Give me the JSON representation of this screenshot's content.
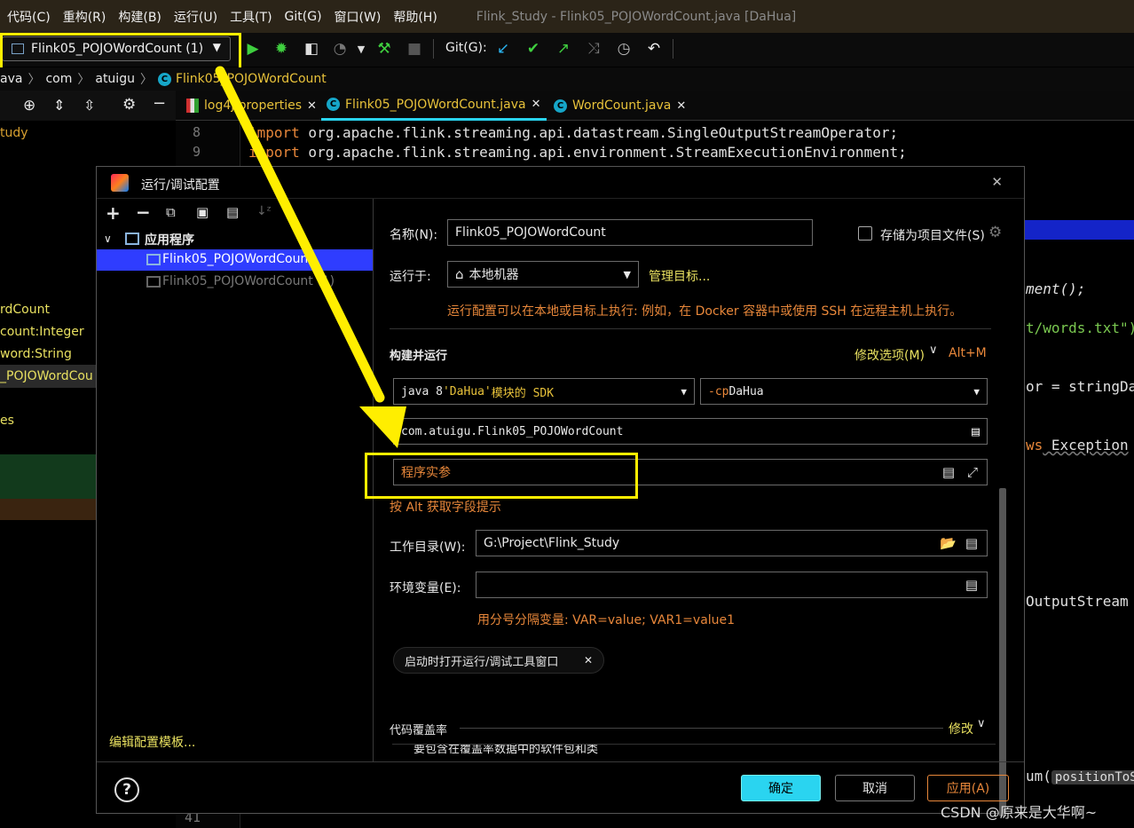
{
  "menu": [
    "代码(C)",
    "重构(R)",
    "构建(B)",
    "运行(U)",
    "工具(T)",
    "Git(G)",
    "窗口(W)",
    "帮助(H)"
  ],
  "window_title": "Flink_Study - Flink05_POJOWordCount.java [DaHua]",
  "toolbar": {
    "run_config": "Flink05_POJOWordCount (1)",
    "git_label": "Git(G):",
    "icons": [
      "run-icon",
      "debug-icon",
      "coverage-icon",
      "profiler-icon",
      "build-icon",
      "stop-icon",
      "git-update-icon",
      "git-commit-icon",
      "git-push-icon",
      "git-merge-icon",
      "history-icon",
      "rollback-icon"
    ]
  },
  "breadcrumb": [
    "ava",
    "com",
    "atuigu",
    "Flink05_POJOWordCount"
  ],
  "editor_tabs": [
    {
      "label": "log4j.properties"
    },
    {
      "label": "Flink05_POJOWordCount.java"
    },
    {
      "label": "WordCount.java"
    }
  ],
  "project_panel": {
    "lines": [
      "tudy",
      "rdCount",
      "count:Integer",
      "word:String",
      "_POJOWordCou",
      "es"
    ]
  },
  "code": {
    "line_numbers": [
      "8",
      "9",
      "41"
    ],
    "line8_kw": "import",
    "line8_rest": " org.apache.flink.streaming.api.datastream.SingleOutputStreamOperator;",
    "line9_kw": "import",
    "line9_rest": " org.apache.flink.streaming.api.environment.StreamExecutionEnvironment;",
    "frag1": "ment();",
    "frag2": "t/words.txt\")",
    "frag3": "or = stringDa",
    "frag4_kw": "ws",
    "frag4_rest": " Exception",
    "frag5": "OutputStream",
    "frag6": "um(",
    "frag6_hint": "positionToS"
  },
  "dialog": {
    "title": "运行/调试配置",
    "tree_root": "应用程序",
    "tree_items": [
      "Flink05_POJOWordCount",
      "Flink05_POJOWordCount (1)"
    ],
    "edit_templates": "编辑配置模板...",
    "name_label": "名称(N):",
    "name_value": "Flink05_POJOWordCount",
    "store_as_file": "存储为项目文件(S)",
    "run_on_label": "运行于:",
    "run_on_value": "本地机器",
    "manage_targets": "管理目标...",
    "run_on_hint": "运行配置可以在本地或目标上执行: 例如，在 Docker 容器中或使用 SSH 在远程主机上执行。",
    "build_run": "构建并运行",
    "modify_options": "修改选项(M)",
    "modify_shortcut": "Alt+M",
    "jdk_prefix": "java 8",
    "jdk_module": " 'DaHua'",
    "jdk_suffix": " 模块的 SDK",
    "cp_flag": "-cp",
    "cp_value": " DaHua",
    "main_class": "com.atuigu.Flink05_POJOWordCount",
    "program_args_placeholder": "程序实参",
    "alt_hint": "按 Alt 获取字段提示",
    "workdir_label": "工作目录(W):",
    "workdir_value": "G:\\Project\\Flink_Study",
    "env_label": "环境变量(E):",
    "env_value": "",
    "env_hint": "用分号分隔变量: VAR=value; VAR1=value1",
    "open_tool_window": "启动时打开运行/调试工具窗口",
    "coverage": "代码覆盖率",
    "coverage_modify": "修改",
    "coverage_sub": "要包含在覆盖率数据中的软件包和类",
    "ok": "确定",
    "cancel": "取消",
    "apply": "应用(A)"
  },
  "watermark": "CSDN @原来是大华啊~",
  "colors": {
    "accent": "#2ad4f0",
    "highlight": "#ffee00",
    "hint": "#e8873a",
    "selection": "#2f3dff"
  }
}
